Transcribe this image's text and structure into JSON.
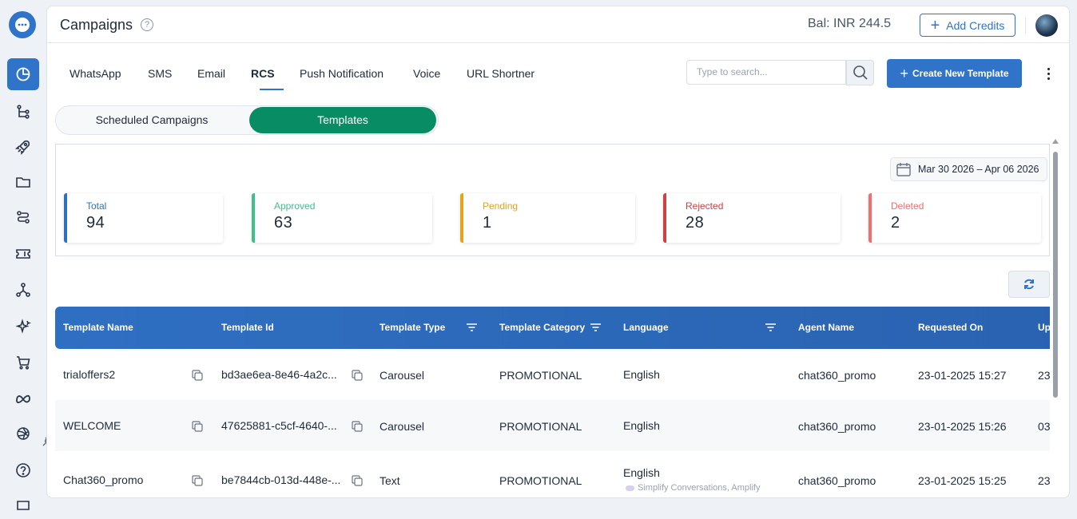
{
  "header": {
    "title": "Campaigns",
    "help_icon": "?",
    "balance": "Bal: INR 244.5",
    "add_credits_label": "Add Credits"
  },
  "channel_tabs": [
    {
      "label": "WhatsApp"
    },
    {
      "label": "SMS"
    },
    {
      "label": "Email"
    },
    {
      "label": "RCS",
      "active": true
    },
    {
      "label": "Push Notification"
    },
    {
      "label": "Voice"
    },
    {
      "label": "URL Shortner"
    }
  ],
  "search": {
    "placeholder": "Type to search..."
  },
  "create_label": "Create New Template",
  "view_toggle": {
    "scheduled": "Scheduled Campaigns",
    "templates": "Templates",
    "selected": "Templates"
  },
  "date_range": "Mar 30 2026 – Apr 06 2026",
  "stats": [
    {
      "label": "Total",
      "value": "94",
      "color": "#2f6fc2"
    },
    {
      "label": "Approved",
      "value": "63",
      "color": "#3ebf8f"
    },
    {
      "label": "Pending",
      "value": "1",
      "color": "#e6a21b"
    },
    {
      "label": "Rejected",
      "value": "28",
      "color": "#cf4040"
    },
    {
      "label": "Deleted",
      "value": "2",
      "color": "#ef6f6f"
    }
  ],
  "table": {
    "columns": [
      "Template Name",
      "Template Id",
      "Template Type",
      "Template Category",
      "Language",
      "Agent Name",
      "Requested On",
      "Up"
    ],
    "rows": [
      {
        "name": "trialoffers2",
        "id": "bd3ae6ea-8e46-4a2c...",
        "type": "Carousel",
        "category": "PROMOTIONAL",
        "language": "English",
        "agent": "chat360_promo",
        "requested": "23-01-2025 15:27",
        "updated": "23"
      },
      {
        "name": "WELCOME",
        "id": "47625881-c5cf-4640-...",
        "type": "Carousel",
        "category": "PROMOTIONAL",
        "language": "English",
        "agent": "chat360_promo",
        "requested": "23-01-2025 15:26",
        "updated": "03"
      },
      {
        "name": "Chat360_promo",
        "id": "be7844cb-013d-448e-...",
        "type": "Text",
        "category": "PROMOTIONAL",
        "language": "English",
        "language_sub": "Simplify Conversations, Amplify",
        "agent": "chat360_promo",
        "requested": "23-01-2025 15:25",
        "updated": "23"
      }
    ]
  },
  "colors": {
    "accent": "#2f74c8",
    "toggle_selected": "#078c63"
  }
}
